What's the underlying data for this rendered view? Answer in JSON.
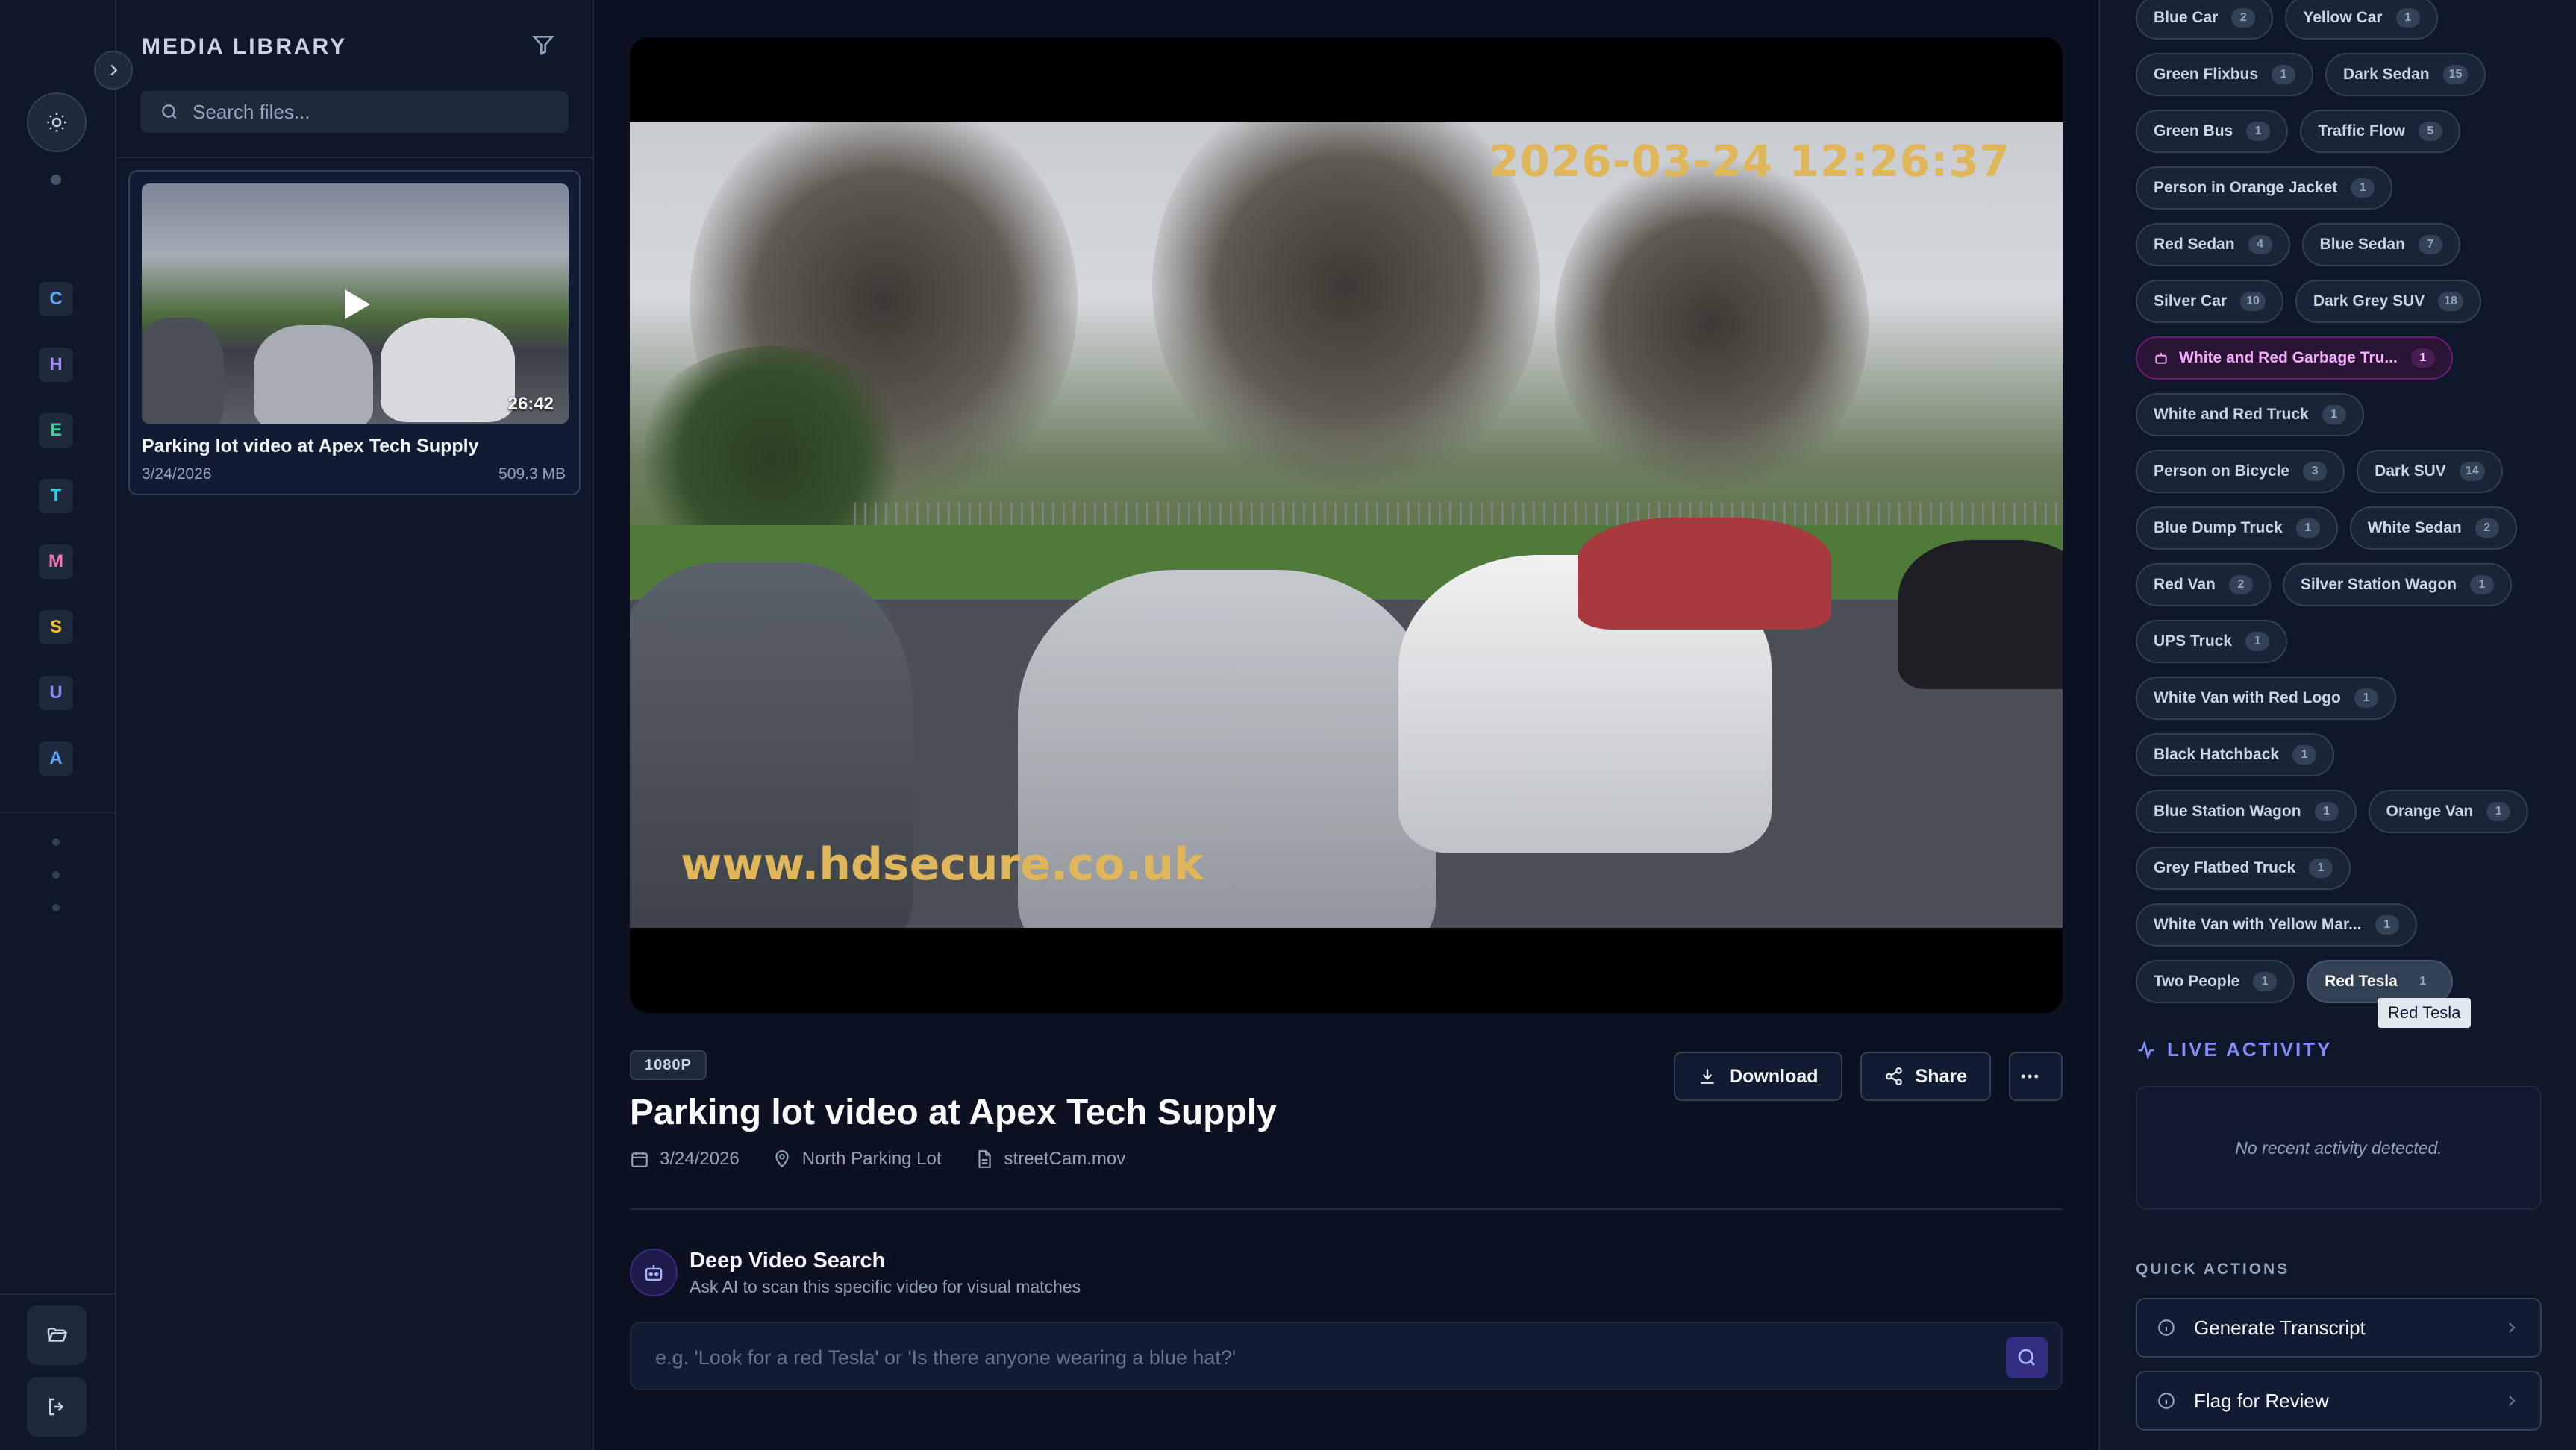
{
  "rail": {
    "letters": [
      {
        "label": "C",
        "color": "#60a5fa",
        "bg": "#1e293b"
      },
      {
        "label": "H",
        "color": "#a78bfa",
        "bg": "#1e293b"
      },
      {
        "label": "E",
        "color": "#34d399",
        "bg": "#1e293b"
      },
      {
        "label": "T",
        "color": "#22d3ee",
        "bg": "#1e293b"
      },
      {
        "label": "M",
        "color": "#f472b6",
        "bg": "#1e293b"
      },
      {
        "label": "S",
        "color": "#fbbf24",
        "bg": "#1e293b"
      },
      {
        "label": "U",
        "color": "#818cf8",
        "bg": "#1e293b"
      },
      {
        "label": "A",
        "color": "#60a5fa",
        "bg": "#1e293b"
      }
    ],
    "icons": {
      "theme": "sun-icon",
      "collapse": "chevron-right-icon",
      "folder": "folder-open-icon",
      "logout": "logout-icon"
    }
  },
  "media": {
    "title": "MEDIA LIBRARY",
    "search_placeholder": "Search files...",
    "items": [
      {
        "title": "Parking lot video at Apex Tech Supply",
        "date": "3/24/2026",
        "size": "509.3 MB",
        "duration": "26:42"
      }
    ]
  },
  "player": {
    "timestamp": "2026-03-24 12:26:37",
    "watermark": "www.hdsecure.co.uk"
  },
  "video": {
    "resolution": "1080P",
    "title": "Parking lot video at Apex Tech Supply",
    "date": "3/24/2026",
    "location": "North Parking Lot",
    "filename": "streetCam.mov",
    "download_label": "Download",
    "share_label": "Share"
  },
  "deep_search": {
    "title": "Deep Video Search",
    "subtitle": "Ask AI to scan this specific video for visual matches",
    "placeholder": "e.g. 'Look for a red Tesla' or 'Is there anyone wearing a blue hat?'"
  },
  "tags": [
    [
      {
        "label": "Blue Car",
        "count": "2"
      },
      {
        "label": "Yellow Car",
        "count": "1"
      }
    ],
    [
      {
        "label": "Green Flixbus",
        "count": "1"
      },
      {
        "label": "Dark Sedan",
        "count": "15"
      }
    ],
    [
      {
        "label": "Green Bus",
        "count": "1"
      },
      {
        "label": "Traffic Flow",
        "count": "5"
      }
    ],
    [
      {
        "label": "Person in Orange Jacket",
        "count": "1"
      }
    ],
    [
      {
        "label": "Red Sedan",
        "count": "4"
      },
      {
        "label": "Blue Sedan",
        "count": "7"
      }
    ],
    [
      {
        "label": "Silver Car",
        "count": "10"
      },
      {
        "label": "Dark Grey SUV",
        "count": "18"
      }
    ],
    [
      {
        "label": "White and Red Garbage Tru...",
        "count": "1",
        "state": "highlight"
      }
    ],
    [
      {
        "label": "White and Red Truck",
        "count": "1"
      }
    ],
    [
      {
        "label": "Person on Bicycle",
        "count": "3"
      },
      {
        "label": "Dark SUV",
        "count": "14"
      }
    ],
    [
      {
        "label": "Blue Dump Truck",
        "count": "1"
      },
      {
        "label": "White Sedan",
        "count": "2"
      }
    ],
    [
      {
        "label": "Red Van",
        "count": "2"
      },
      {
        "label": "Silver Station Wagon",
        "count": "1"
      }
    ],
    [
      {
        "label": "UPS Truck",
        "count": "1"
      }
    ],
    [
      {
        "label": "White Van with Red Logo",
        "count": "1"
      }
    ],
    [
      {
        "label": "Black Hatchback",
        "count": "1"
      }
    ],
    [
      {
        "label": "Blue Station Wagon",
        "count": "1"
      },
      {
        "label": "Orange Van",
        "count": "1"
      }
    ],
    [
      {
        "label": "Grey Flatbed Truck",
        "count": "1"
      }
    ],
    [
      {
        "label": "White Van with Yellow Mar...",
        "count": "1"
      }
    ],
    [
      {
        "label": "Two People",
        "count": "1"
      },
      {
        "label": "Red Tesla",
        "count": "1",
        "state": "active"
      }
    ]
  ],
  "tooltip": "Red Tesla",
  "live_activity": {
    "title": "LIVE ACTIVITY",
    "empty": "No recent activity detected."
  },
  "quick_actions": {
    "title": "QUICK ACTIONS",
    "items": [
      {
        "label": "Generate Transcript"
      },
      {
        "label": "Flag for Review"
      }
    ]
  },
  "colors": {
    "accent": "#818cf8",
    "highlight_tag": "#f0abfc"
  }
}
